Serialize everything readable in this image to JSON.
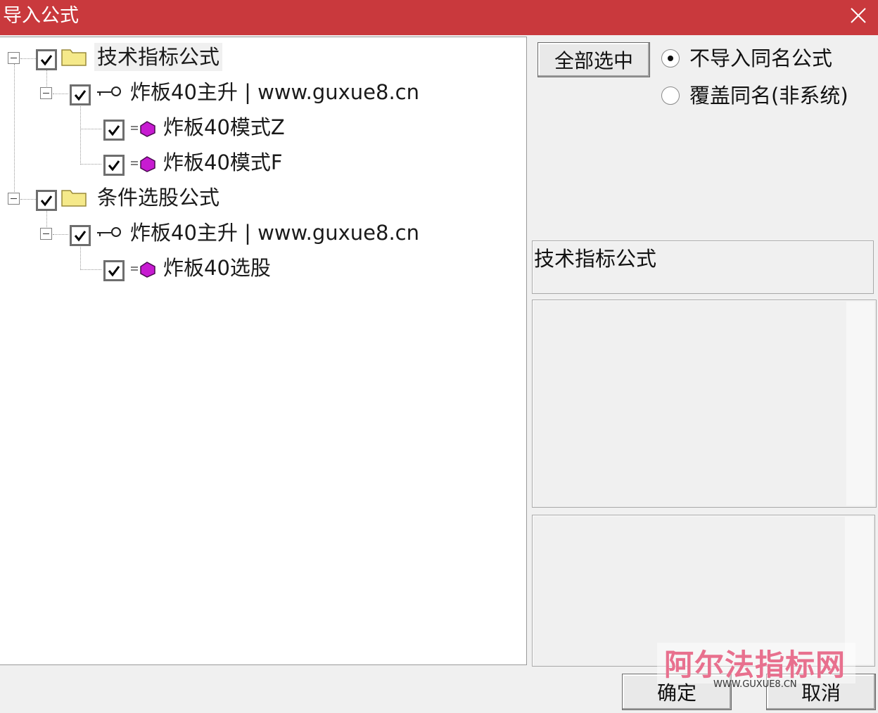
{
  "window": {
    "title": "导入公式"
  },
  "tree": {
    "groups": [
      {
        "label": "技术指标公式",
        "checked": true,
        "children": [
          {
            "label": "炸板40主升 | www.guxue8.cn",
            "checked": true,
            "children": [
              {
                "label": "炸板40模式Z",
                "checked": true
              },
              {
                "label": "炸板40模式F",
                "checked": true
              }
            ]
          }
        ]
      },
      {
        "label": "条件选股公式",
        "checked": true,
        "children": [
          {
            "label": "炸板40主升 | www.guxue8.cn",
            "checked": true,
            "children": [
              {
                "label": "炸板40选股",
                "checked": true
              }
            ]
          }
        ]
      }
    ]
  },
  "options": {
    "select_all_label": "全部选中",
    "radio_no_import_label": "不导入同名公式",
    "radio_overwrite_label": "覆盖同名(非系统)",
    "selected": "不导入同名公式"
  },
  "info": {
    "type_label": "技术指标公式"
  },
  "footer": {
    "ok_label": "确定",
    "cancel_label": "取消"
  },
  "watermark": {
    "main": "阿尔法指标网",
    "sub": "WWW.GUXUE8.CN"
  },
  "colors": {
    "titlebar": "#c9393d",
    "formula_icon": "#c71bd1",
    "folder_icon": "#f5e98a",
    "watermark": "#e8708e"
  }
}
